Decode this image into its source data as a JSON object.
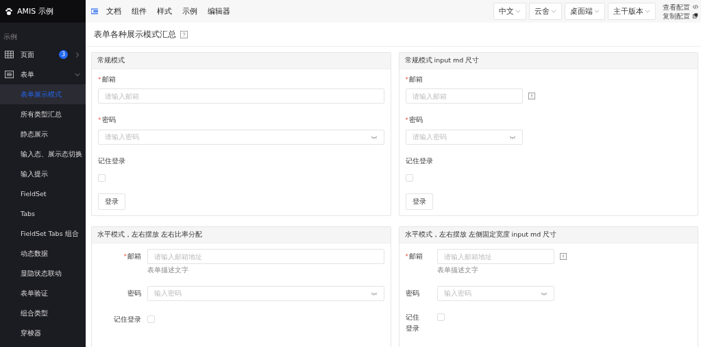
{
  "sidebar": {
    "brand": "AMIS 示例",
    "section": "示例",
    "groups": [
      {
        "label": "页面",
        "badge": "3",
        "expanded": false
      },
      {
        "label": "表单",
        "expanded": true
      }
    ],
    "items": [
      {
        "label": "表单展示模式",
        "selected": true
      },
      {
        "label": "所有类型汇总",
        "selected": false
      },
      {
        "label": "静态展示",
        "selected": false
      },
      {
        "label": "输入态、展示态切换",
        "selected": false
      },
      {
        "label": "输入提示",
        "selected": false
      },
      {
        "label": "FieldSet",
        "selected": false
      },
      {
        "label": "Tabs",
        "selected": false
      },
      {
        "label": "FieldSet Tabs 组合",
        "selected": false
      },
      {
        "label": "动态数据",
        "selected": false
      },
      {
        "label": "显隐状态联动",
        "selected": false
      },
      {
        "label": "表单验证",
        "selected": false
      },
      {
        "label": "组合类型",
        "selected": false
      },
      {
        "label": "穿梭器",
        "selected": false
      }
    ]
  },
  "topnav": {
    "links": [
      "文档",
      "组件",
      "样式",
      "示例",
      "编辑器"
    ],
    "dropdowns": [
      "中文",
      "云舍",
      "桌面端",
      "主干版本"
    ],
    "actions": [
      "查看配置",
      "复制配置"
    ]
  },
  "page": {
    "title": "表单各种展示模式汇总"
  },
  "panels": [
    {
      "title": "常规模式",
      "kind": "vertical",
      "md": false,
      "fields": [
        {
          "kind": "text",
          "label": "邮箱",
          "mark": "*",
          "placeholder": "请输入邮箱",
          "info": false
        },
        {
          "kind": "password",
          "label": "密码",
          "mark": "*",
          "placeholder": "请输入密码"
        },
        {
          "kind": "checkbox",
          "label": "记住登录",
          "checked": false
        }
      ],
      "button": "登录"
    },
    {
      "title": "常规模式 input md 尺寸",
      "kind": "vertical",
      "md": true,
      "fields": [
        {
          "kind": "text",
          "label": "邮箱",
          "mark": "*",
          "placeholder": "请输入邮箱",
          "info": true
        },
        {
          "kind": "password",
          "label": "密码",
          "mark": "*",
          "placeholder": "请输入密码"
        },
        {
          "kind": "checkbox",
          "label": "记住登录",
          "checked": false
        }
      ],
      "button": "登录"
    },
    {
      "title": "水平模式，左右摆放 左右比率分配",
      "kind": "horizontal",
      "md": false,
      "fields": [
        {
          "kind": "text",
          "label": "邮箱",
          "mark": "*",
          "placeholder": "请输入邮箱地址",
          "info": false,
          "description": "表单描述文字"
        },
        {
          "kind": "password",
          "label": "密码",
          "placeholder": "输入密码"
        },
        {
          "kind": "checkbox",
          "label": "记住登录",
          "checked": false
        }
      ]
    },
    {
      "title": "水平模式，左右摆放 左侧固定宽度 input md 尺寸",
      "kind": "fixed",
      "md": true,
      "fields": [
        {
          "kind": "text",
          "label": "邮箱",
          "mark": "*",
          "placeholder": "请输入邮箱地址",
          "info": true,
          "description": "表单描述文字"
        },
        {
          "kind": "password",
          "label": "密码",
          "placeholder": "输入密码"
        },
        {
          "kind": "checkbox",
          "label": "记住登录",
          "checked": false
        }
      ]
    }
  ]
}
